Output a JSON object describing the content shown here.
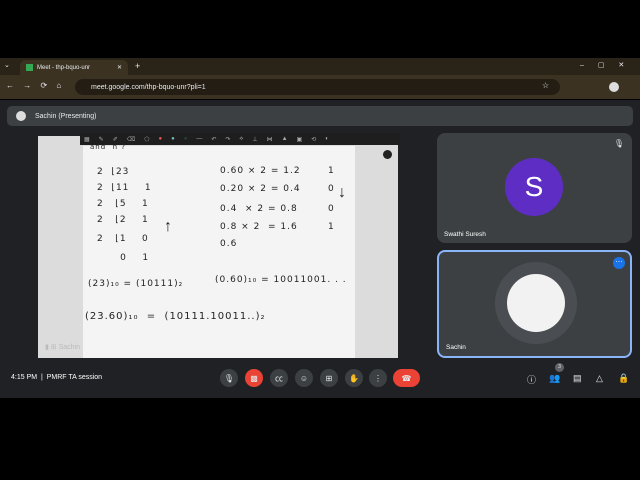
{
  "browser": {
    "tab_title": "Meet - thp-bquo-unr",
    "url": "meet.google.com/thp-bquo-unr?pli=1"
  },
  "banner": {
    "presenter": "Sachin (Presenting)"
  },
  "presentation": {
    "footer_name": "Sachin",
    "lines": {
      "q": "and  n ?",
      "d0": "2  ⌊23",
      "d1": "2  ⌊11    1",
      "d2": "2   ⌊5    1",
      "d3": "2   ⌊2    1",
      "d4": "2   ⌊1    0",
      "d5": "      0    1",
      "f0": "0.60 × 2 = 1.2",
      "f1": "0.20 × 2 = 0.4",
      "f2": "0.4  × 2 = 0.8",
      "f3": "0.8 × 2  = 1.6",
      "f4": "0.6",
      "b0": "1",
      "b1": "0",
      "b2": "0",
      "b3": "1",
      "r1": "(23)₁₀ = (10111)₂",
      "r2": "(0.60)₁₀ = 10011001. . .",
      "r3": "(23.60)₁₀  =  (10111.10011..)₂"
    }
  },
  "participants": [
    {
      "name": "Swathi Suresh",
      "initial": "S",
      "color": "#5e2ec4"
    },
    {
      "name": "Sachin"
    }
  ],
  "bottom": {
    "time": "4:15 PM",
    "meeting": "PMRF TA session",
    "people_count": "3"
  }
}
